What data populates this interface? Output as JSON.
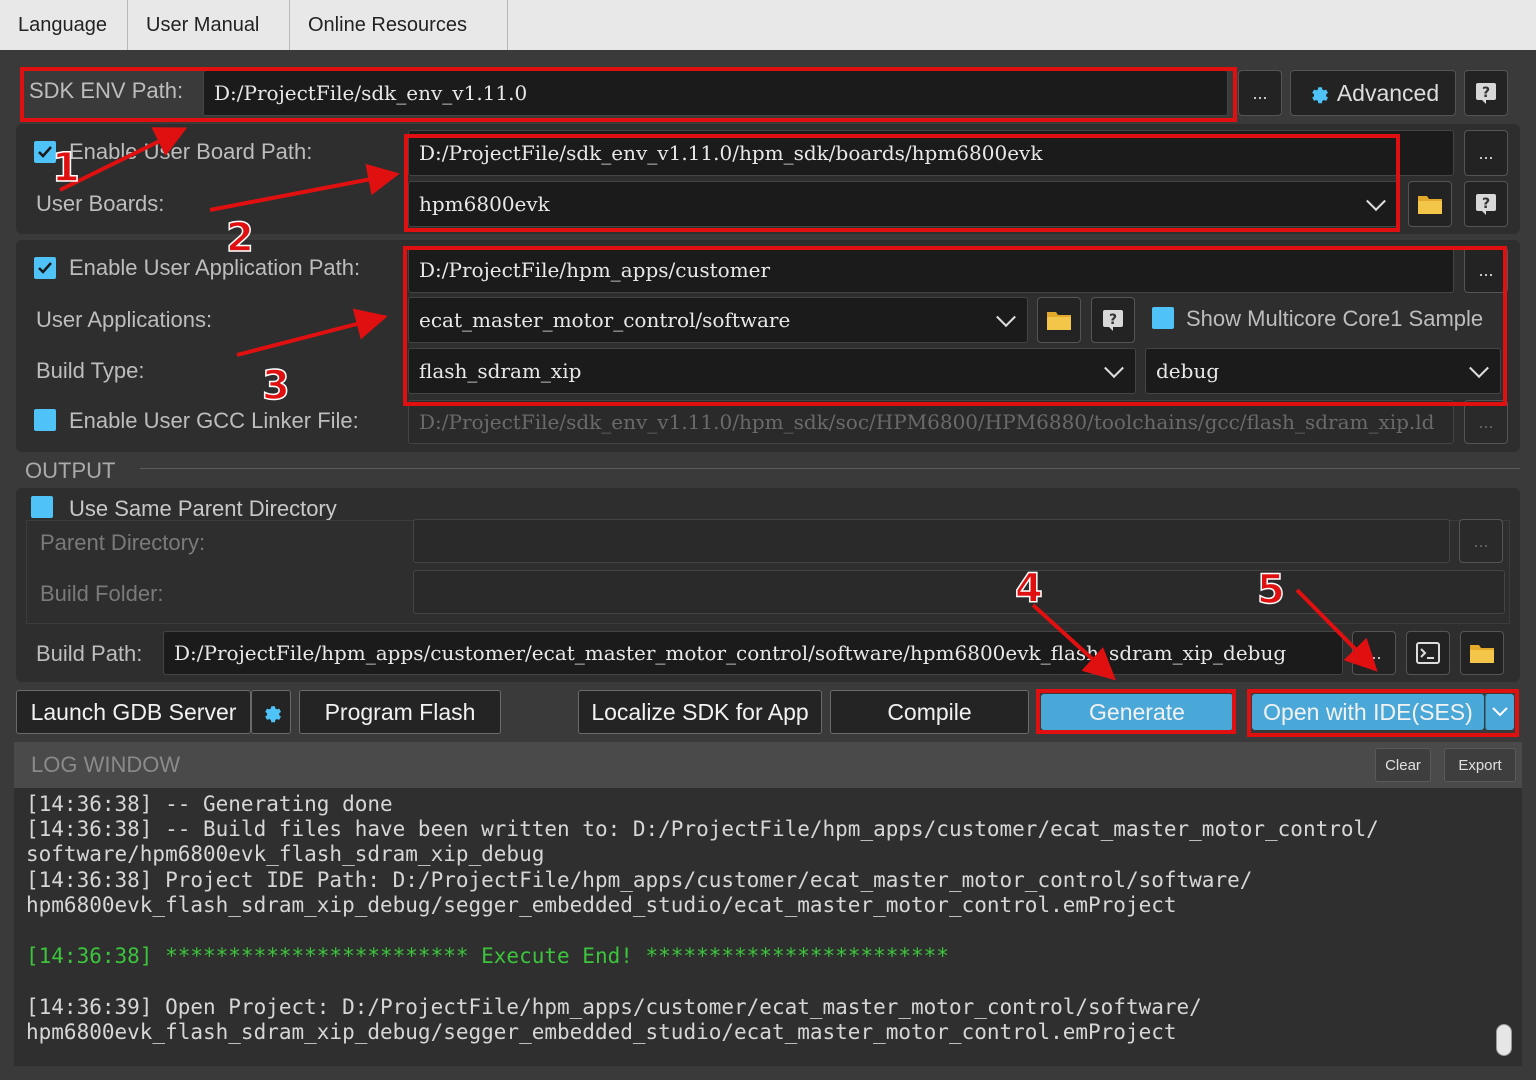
{
  "menu": [
    "Language",
    "User Manual",
    "Online Resources"
  ],
  "sdk": {
    "label": "SDK ENV Path:",
    "path": "D:/ProjectFile/sdk_env_v1.11.0",
    "browse": "...",
    "advanced": "Advanced",
    "help": "?"
  },
  "board": {
    "enable_label": "Enable User Board Path:",
    "enabled": true,
    "path": "D:/ProjectFile/sdk_env_v1.11.0/hpm_sdk/boards/hpm6800evk",
    "browse": "...",
    "boards_label": "User Boards:",
    "selected_board": "hpm6800evk"
  },
  "application": {
    "enable_label": "Enable User Application Path:",
    "enabled": true,
    "path": "D:/ProjectFile/hpm_apps/customer",
    "browse": "...",
    "apps_label": "User Applications:",
    "selected_app": "ecat_master_motor_control/software",
    "multicore_label": "Show Multicore Core1 Sample",
    "multicore_checked": false,
    "build_type_label": "Build Type:",
    "build_type": "flash_sdram_xip",
    "build_config": "debug",
    "linker_label": "Enable User GCC Linker File:",
    "linker_checked": false,
    "linker_path": "D:/ProjectFile/sdk_env_v1.11.0/hpm_sdk/soc/HPM6800/HPM6880/toolchains/gcc/flash_sdram_xip.ld"
  },
  "output": {
    "section_title": "OUTPUT",
    "same_parent_label": "Use Same Parent Directory",
    "same_parent_checked": false,
    "parent_dir_label": "Parent Directory:",
    "build_folder_label": "Build Folder:",
    "build_path_label": "Build Path:",
    "build_path": "D:/ProjectFile/hpm_apps/customer/ecat_master_motor_control/software/hpm6800evk_flash_sdram_xip_debug",
    "browse": "..."
  },
  "actions": {
    "launch_gdb": "Launch GDB Server",
    "program_flash": "Program Flash",
    "localize_sdk": "Localize SDK for App",
    "compile": "Compile",
    "generate": "Generate",
    "open_ide": "Open with IDE(SES)"
  },
  "log": {
    "title": "LOG WINDOW",
    "clear": "Clear",
    "export": "Export",
    "lines": [
      "[14:36:38] -- Generating done",
      "[14:36:38] -- Build files have been written to: D:/ProjectFile/hpm_apps/customer/ecat_master_motor_control/",
      "software/hpm6800evk_flash_sdram_xip_debug",
      "[14:36:38] Project IDE Path: D:/ProjectFile/hpm_apps/customer/ecat_master_motor_control/software/",
      "hpm6800evk_flash_sdram_xip_debug/segger_embedded_studio/ecat_master_motor_control.emProject",
      "[14:36:38] ************************ Execute End! ************************",
      "[14:36:39] Open Project: D:/ProjectFile/hpm_apps/customer/ecat_master_motor_control/software/",
      "hpm6800evk_flash_sdram_xip_debug/segger_embedded_studio/ecat_master_motor_control.emProject"
    ]
  },
  "annotations": [
    "1",
    "2",
    "3",
    "4",
    "5"
  ],
  "colors": {
    "accent": "#4fc3f7",
    "annotation_red": "#e01010",
    "log_green": "#3cc43c"
  }
}
